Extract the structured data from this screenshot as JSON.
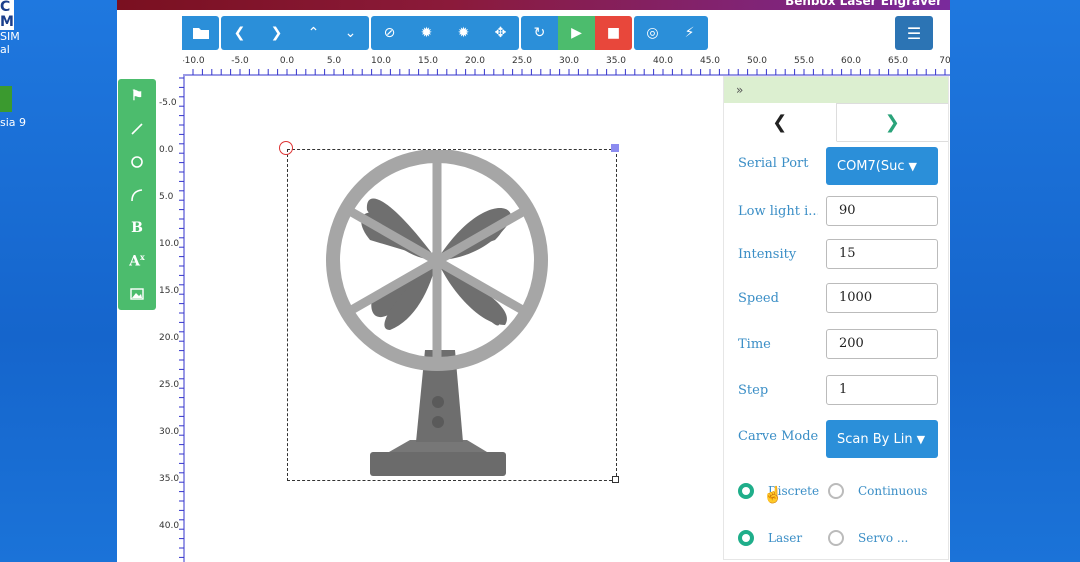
{
  "desktop": {
    "icon1": {
      "glyph": "C\nM",
      "lines": [
        "SIM",
        "al"
      ]
    },
    "icon2": {
      "label": "sia 9"
    }
  },
  "app": {
    "title": "Benbox Laser Engraver",
    "accent": "#2b8fd9",
    "green": "#4cbc6d",
    "red": "#e8473b"
  },
  "toolbar": {
    "groups": [
      [
        "folder-open-icon"
      ],
      [
        "chevron-left-icon",
        "chevron-right-icon",
        "chevron-up-icon",
        "chevron-down-icon"
      ],
      [
        "ban-icon",
        "dot-small-icon",
        "dot-large-icon",
        "crosshair-icon"
      ],
      [
        "repeat-icon",
        "play-icon",
        "stop-icon"
      ],
      [
        "target-icon",
        "bolt-icon"
      ]
    ],
    "menu_icon": "hamburger-icon"
  },
  "ruler": {
    "h_labels": [
      "-10.0",
      "-5.0",
      "0.0",
      "5.0",
      "10.0",
      "15.0",
      "20.0",
      "25.0",
      "30.0",
      "35.0",
      "40.0",
      "45.0",
      "50.0",
      "55.0",
      "60.0",
      "65.0",
      "70"
    ],
    "v_labels": [
      "-5.0",
      "0.0",
      "5.0",
      "10.0",
      "15.0",
      "20.0",
      "25.0",
      "30.0",
      "35.0",
      "40.0"
    ]
  },
  "drawtools": [
    "tag-icon",
    "line-icon",
    "circle-icon",
    "arc-icon",
    "bold-text-icon",
    "text-size-icon",
    "image-icon"
  ],
  "panel": {
    "collapse": "»",
    "fields": {
      "serial_port": {
        "label": "Serial Port",
        "value": "COM7(Suc"
      },
      "low_light": {
        "label": "Low light i...",
        "value": "90"
      },
      "intensity": {
        "label": "Intensity",
        "value": "15"
      },
      "speed": {
        "label": "Speed",
        "value": "1000"
      },
      "time": {
        "label": "Time",
        "value": "200"
      },
      "step": {
        "label": "Step",
        "value": "1"
      },
      "carve_mode": {
        "label": "Carve Mode",
        "value": "Scan By Lin"
      }
    },
    "radios": {
      "discrete": "Discrete",
      "continuous": "Continuous",
      "laser": "Laser",
      "servo": "Servo ..."
    }
  }
}
